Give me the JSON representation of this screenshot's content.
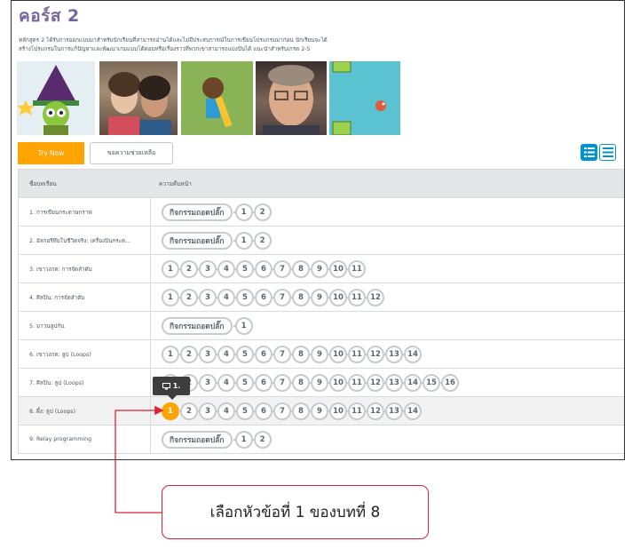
{
  "course": {
    "title": "คอร์ส 2",
    "description_line1": "หลักสูตร 2 ได้รับการออกแบบมาสำหรับนักเรียนที่สามารถอ่านได้และไม่มีประสบการณ์ในการเขียนโปรแกรมมาก่อน นักเรียนจะได้",
    "description_line2": "สร้างโปรแกรมในการแก้ปัญหาและพัฒนาเกมแบบโต้ตอบหรือเรื่องราวที่พวกเขาสามารถแบ่งปันได้ แนะนำสำหรับเกรด 2-5"
  },
  "buttons": {
    "try_now": "Try Now",
    "help": "ขอความช่วยเหลือ"
  },
  "table": {
    "headers": {
      "lesson": "ชื่อบทเรียน",
      "progress": "ความคืบหน้า"
    },
    "rows": [
      {
        "name": "1. การเขียนกระดาษกราฟ",
        "pill": "กิจกรรมถอดปลั๊ก",
        "levels": [
          "1",
          "2"
        ]
      },
      {
        "name": "2. อัลกอริทึมในชีวิตจริง: เครื่องบินกระด...",
        "pill": "กิจกรรมถอดปลั๊ก",
        "levels": [
          "1",
          "2"
        ]
      },
      {
        "name": "3. เขาวงกต: การจัดลำดับ",
        "pill": "",
        "levels": [
          "1",
          "2",
          "3",
          "4",
          "5",
          "6",
          "7",
          "8",
          "9",
          "10",
          "11"
        ]
      },
      {
        "name": "4. ศิลปิน: การจัดลำดับ",
        "pill": "",
        "levels": [
          "1",
          "2",
          "3",
          "4",
          "5",
          "6",
          "7",
          "8",
          "9",
          "10",
          "11",
          "12"
        ]
      },
      {
        "name": "5. มาวนลูปกัน",
        "pill": "กิจกรรมถอดปลั๊ก",
        "levels": [
          "1"
        ]
      },
      {
        "name": "6. เขาวงกต: ลูป (Loops)",
        "pill": "",
        "levels": [
          "1",
          "2",
          "3",
          "4",
          "5",
          "6",
          "7",
          "8",
          "9",
          "10",
          "11",
          "12",
          "13",
          "14"
        ]
      },
      {
        "name": "7. ศิลปิน: ลูป (Loops)",
        "pill": "",
        "levels": [
          "1",
          "2",
          "3",
          "4",
          "5",
          "6",
          "7",
          "8",
          "9",
          "10",
          "11",
          "12",
          "13",
          "14",
          "15",
          "16"
        ]
      },
      {
        "name": "8. ผึ้ง: ลูป (Loops)",
        "pill": "",
        "levels": [
          "1",
          "2",
          "3",
          "4",
          "5",
          "6",
          "7",
          "8",
          "9",
          "10",
          "11",
          "12",
          "13",
          "14"
        ]
      },
      {
        "name": "9. Relay programming",
        "pill": "กิจกรรมถอดปลั๊ก",
        "levels": [
          "1",
          "2"
        ]
      }
    ]
  },
  "tooltip": {
    "label": "1."
  },
  "callout": {
    "text": "เลือกหัวข้อที่ 1 ของบทที่ 8"
  },
  "colors": {
    "accent": "#ffa400",
    "title": "#7665a0",
    "callout_border": "#e0203a",
    "view_toggle": "#0094ca"
  }
}
